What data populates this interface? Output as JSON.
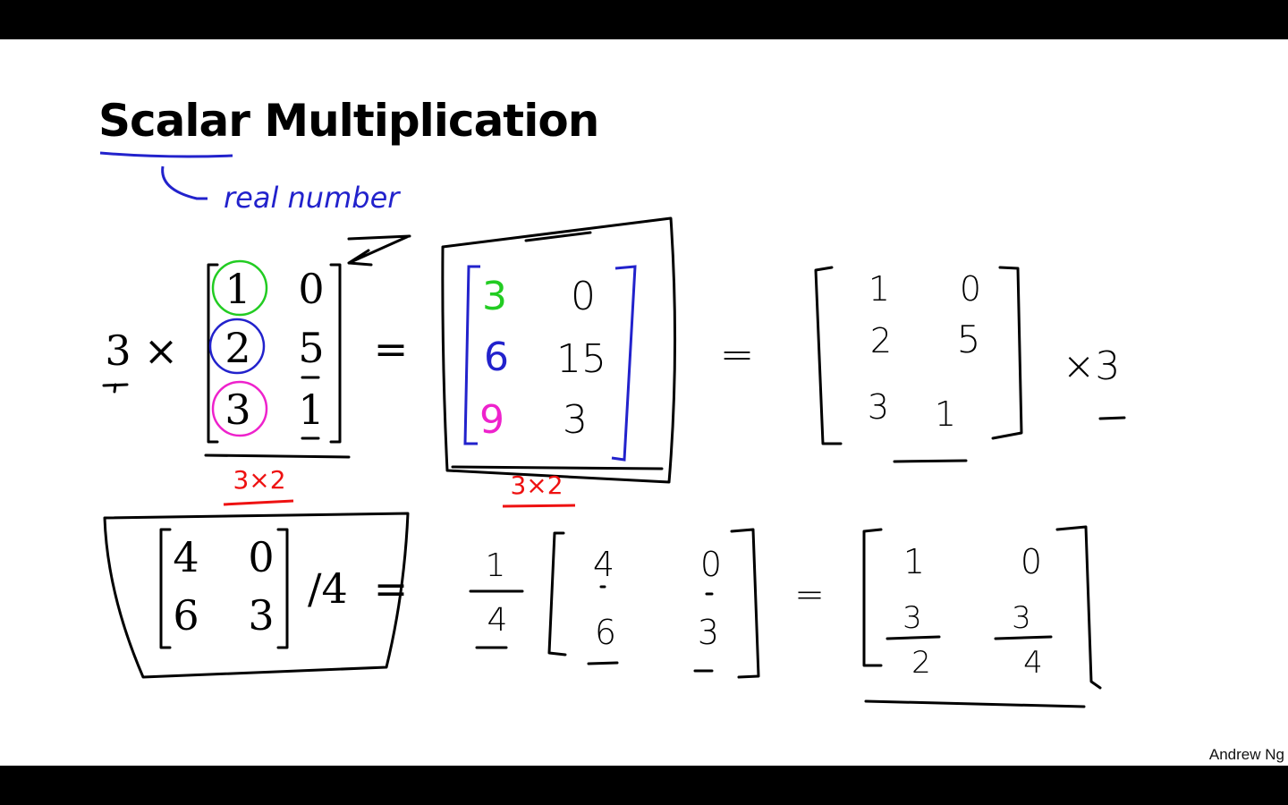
{
  "slide": {
    "title": "Scalar Multiplication",
    "note": "real number",
    "credit": "Andrew Ng"
  },
  "example1": {
    "scalar": "3",
    "times": "×",
    "matrix": [
      [
        "1",
        "0"
      ],
      [
        "2",
        "5"
      ],
      [
        "3",
        "1"
      ]
    ],
    "equals": "=",
    "dim": "3×2",
    "result": [
      [
        "3",
        "0"
      ],
      [
        "6",
        "15"
      ],
      [
        "9",
        "3"
      ]
    ],
    "result_dim": "3×2",
    "equals2": "=",
    "matrix_again": [
      [
        "1",
        "0"
      ],
      [
        "2",
        "5"
      ],
      [
        "3",
        "1"
      ]
    ],
    "times_scalar": "×3"
  },
  "example2": {
    "matrix": [
      [
        "4",
        "0"
      ],
      [
        "6",
        "3"
      ]
    ],
    "divide": "/4",
    "equals": "=",
    "frac_num": "1",
    "frac_den": "4",
    "matrix2": [
      [
        "4",
        "0"
      ],
      [
        "6",
        "3"
      ]
    ],
    "equals2": "=",
    "r11": "1",
    "r12": "0",
    "r21_num": "3",
    "r21_den": "2",
    "r22_num": "3",
    "r22_den": "4"
  },
  "colors": {
    "green": "#22cc22",
    "blue": "#2222cc",
    "magenta": "#ee22cc",
    "red": "#ee1111",
    "ink": "#000000"
  }
}
